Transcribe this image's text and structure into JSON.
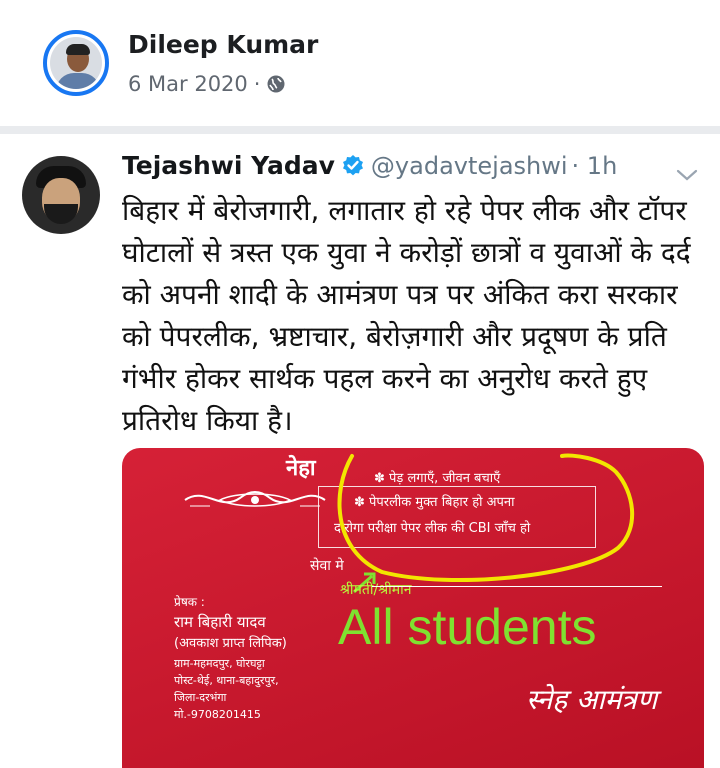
{
  "post": {
    "author": "Dileep Kumar",
    "date": "6 Mar 2020",
    "separator": "·",
    "audience_icon": "globe-icon"
  },
  "tweet": {
    "name": "Tejashwi Yadav",
    "handle": "@yadavtejashwi",
    "time": "· 1h",
    "verified_icon": "verified-icon",
    "menu_icon": "chevron-down-icon",
    "text": "बिहार में बेरोजगारी, लगातार हो रहे पेपर लीक और टॉपर घोटालों से त्रस्त एक युवा ने करोड़ों छात्रों व युवाओं के दर्द को अपनी शादी के आमंत्रण पत्र पर अंकित करा सरकार को पेपरलीक, भ्रष्टाचार, बेरोज़गारी और प्रदूषण के प्रति गंभीर होकर सार्थक पहल करने का अनुरोध करते हुए प्रतिरोध किया है।"
  },
  "card": {
    "heading": "नेहा",
    "slogans": [
      "✽ पेड़ लगाएँ, जीवन बचाएँ",
      "✽ पेपरलीक मुक्त बिहार हो अपना",
      "दारोगा परीक्षा पेपर लीक की CBI जाँच हो"
    ],
    "to_label": "सेवा मे",
    "recipient_label": "श्रीमती/श्रीमान",
    "overlay_text": "All students",
    "sender": {
      "label": "प्रेषक :",
      "name": "राम बिहारी यादव",
      "title": "(अवकाश प्राप्त लिपिक)",
      "address_1": "ग्राम-महमदपुर, घोरघट्टा",
      "address_2": "पोस्ट-थेई, थाना-बहादुरपुर,",
      "district": "जिला-दरभंगा",
      "phone": "मो.-9708201415"
    },
    "brand": "स्नेह आमंत्रण",
    "colors": {
      "card_red": "#d3132a",
      "highlight": "#f2e600",
      "overlay_green": "#7fe230"
    }
  },
  "colors": {
    "facebook_blue": "#1877f2",
    "twitter_blue": "#1da1f2",
    "muted_gray": "#657786"
  }
}
